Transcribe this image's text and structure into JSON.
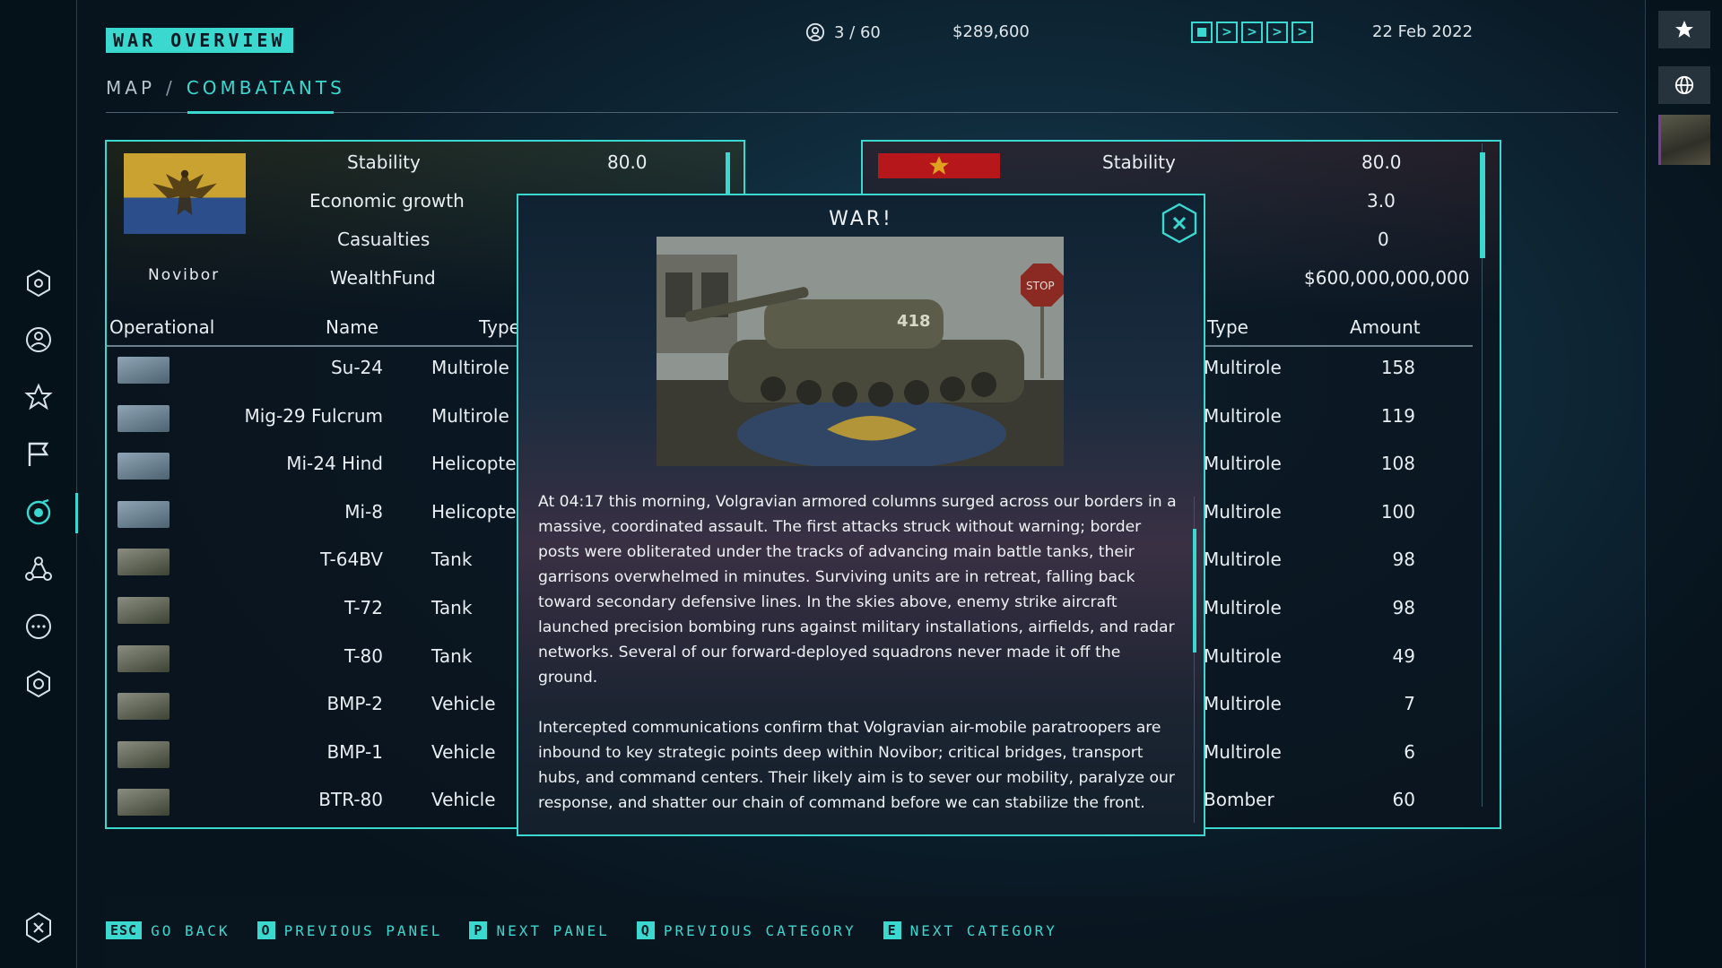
{
  "header": {
    "title": "WAR OVERVIEW",
    "breadcrumb": {
      "map": "MAP",
      "separator": "/",
      "current": "COMBATANTS"
    },
    "players": "3 / 60",
    "money": "$289,600",
    "date": "22 Feb 2022",
    "speed_controls": [
      "pause",
      "speed-1",
      "speed-2",
      "speed-3",
      "speed-4"
    ]
  },
  "left_panel": {
    "country": "Novibor",
    "stats": [
      {
        "label": "Stability",
        "value": "80.0"
      },
      {
        "label": "Economic growth",
        "value": ""
      },
      {
        "label": "Casualties",
        "value": ""
      },
      {
        "label": "WealthFund",
        "value": ""
      }
    ],
    "columns": {
      "operational": "Operational",
      "name": "Name",
      "type": "Type"
    },
    "units": [
      {
        "name": "Su-24",
        "type": "Multirole",
        "kind": "air"
      },
      {
        "name": "Mig-29 Fulcrum",
        "type": "Multirole",
        "kind": "air"
      },
      {
        "name": "Mi-24 Hind",
        "type": "Helicopter",
        "kind": "air"
      },
      {
        "name": "Mi-8",
        "type": "Helicopter",
        "kind": "air"
      },
      {
        "name": "T-64BV",
        "type": "Tank",
        "kind": "ground"
      },
      {
        "name": "T-72",
        "type": "Tank",
        "kind": "ground"
      },
      {
        "name": "T-80",
        "type": "Tank",
        "kind": "ground"
      },
      {
        "name": "BMP-2",
        "type": "Vehicle",
        "kind": "ground"
      },
      {
        "name": "BMP-1",
        "type": "Vehicle",
        "kind": "ground"
      },
      {
        "name": "BTR-80",
        "type": "Vehicle",
        "kind": "ground"
      }
    ]
  },
  "right_panel": {
    "stats": [
      {
        "label": "Stability",
        "value": "80.0"
      },
      {
        "label": "",
        "value": "3.0"
      },
      {
        "label": "",
        "value": "0"
      },
      {
        "label": "",
        "value": "$600,000,000,000"
      }
    ],
    "columns": {
      "type": "Type",
      "amount": "Amount"
    },
    "units": [
      {
        "type": "Multirole",
        "amount": "158"
      },
      {
        "type": "Multirole",
        "amount": "119"
      },
      {
        "type": "Multirole",
        "amount": "108"
      },
      {
        "type": "Multirole",
        "amount": "100"
      },
      {
        "type": "Multirole",
        "amount": "98"
      },
      {
        "type": "Multirole",
        "amount": "98"
      },
      {
        "type": "Multirole",
        "amount": "49"
      },
      {
        "type": "Multirole",
        "amount": "7"
      },
      {
        "type": "Multirole",
        "amount": "6"
      },
      {
        "type": "Bomber",
        "amount": "60"
      }
    ]
  },
  "modal": {
    "title": "WAR!",
    "image_number": "418",
    "image_sign": "STOP",
    "body": "At 04:17 this morning, Volgravian armored columns surged across our borders in a massive, coordinated assault. The first attacks struck without warning; border posts were obliterated under the tracks of advancing main battle tanks, their garrisons overwhelmed in minutes. Surviving units are in retreat, falling back toward secondary defensive lines. In the skies above, enemy strike aircraft launched precision bombing runs against military installations, airfields, and radar networks. Several of our forward-deployed squadrons never made it off the ground.\n\nIntercepted communications confirm that Volgravian air-mobile paratroopers are inbound to key strategic points deep within Novibor; critical bridges, transport hubs, and command centers. Their likely aim is to sever our mobility, paralyze our response, and shatter our chain of command before we can stabilize the front."
  },
  "footer": [
    {
      "key": "ESC",
      "label": "GO BACK"
    },
    {
      "key": "O",
      "label": "PREVIOUS PANEL"
    },
    {
      "key": "P",
      "label": "NEXT PANEL"
    },
    {
      "key": "Q",
      "label": "PREVIOUS CATEGORY"
    },
    {
      "key": "E",
      "label": "NEXT CATEGORY"
    }
  ],
  "nav": [
    "home-hex-icon",
    "profile-icon",
    "star-icon",
    "flag-icon",
    "target-icon",
    "network-icon",
    "chat-icon",
    "settings-hex-icon"
  ],
  "colors": {
    "accent": "#3bd8d0",
    "background": "#0f2a3a"
  }
}
